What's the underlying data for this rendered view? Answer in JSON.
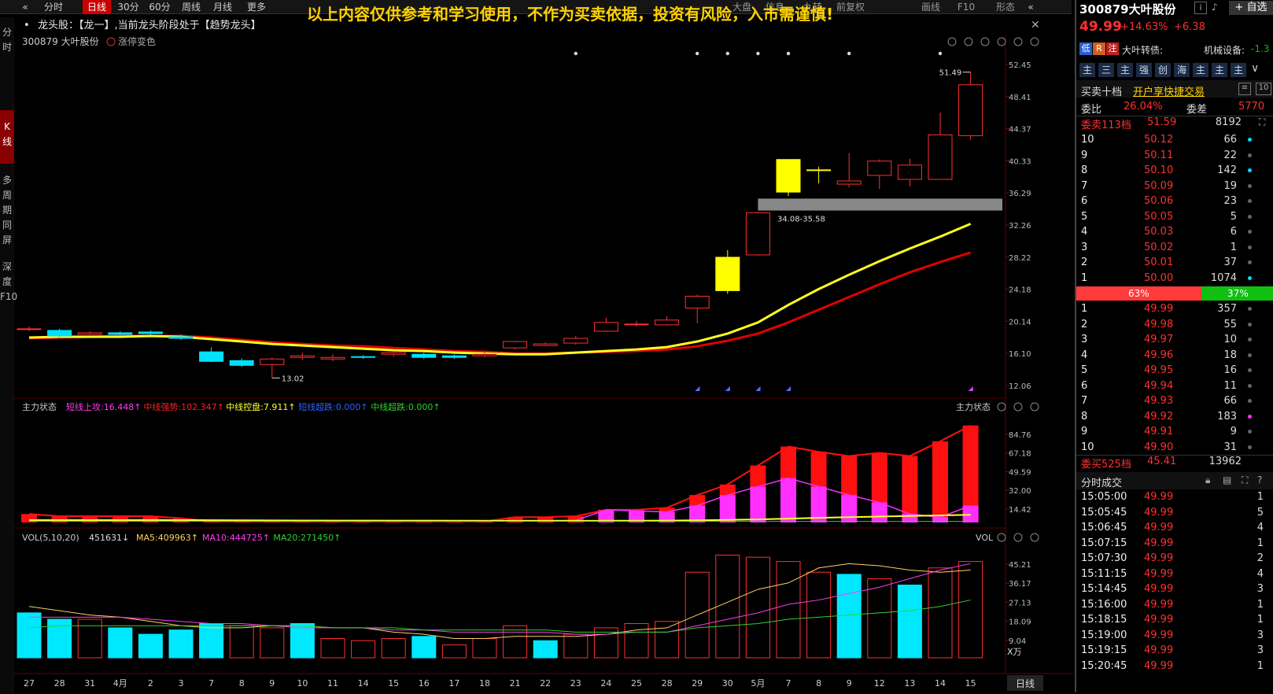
{
  "toolbar": {
    "tabs": [
      "分时",
      "日线",
      "30分",
      "60分",
      "周线",
      "月线",
      "更多"
    ],
    "active_tab": "日线",
    "right_tabs": [
      "大盘",
      "信息",
      "九转",
      "前复权",
      "画线",
      "F10",
      "形态"
    ]
  },
  "banner": "以上内容仅供参考和学习使用，不作为买卖依据，投资有风险，入市需谨慎!",
  "leftnav": {
    "fenshi": "分时",
    "kxian": "K线",
    "duozhouqi": "多周期同屏",
    "shendu": "深度F10"
  },
  "info_line": "龙头股：【龙一】,当前龙头阶段处于【趋势龙头】",
  "chart_header": {
    "code_name": "300879 大叶股份",
    "limit_toggle": "涨停变色"
  },
  "price_axis": [
    "52.45",
    "48.41",
    "44.37",
    "40.33",
    "36.29",
    "32.26",
    "28.22",
    "24.18",
    "20.14",
    "16.10",
    "12.06"
  ],
  "annotations": {
    "high": "51.49",
    "low": "13.02",
    "gap": "34.08-35.58"
  },
  "indicator1": {
    "title": "主力状态",
    "items": [
      {
        "label": "短线上攻:16.448",
        "color": "#ff3cf0"
      },
      {
        "label": "中线强势:102.347",
        "color": "#ff2020"
      },
      {
        "label": "中线控盘:7.911",
        "color": "#ffff30"
      },
      {
        "label": "短线超跌:0.000",
        "color": "#3060ff"
      },
      {
        "label": "中线超跌:0.000",
        "color": "#30d030"
      }
    ],
    "right_title": "主力状态",
    "axis": [
      "84.76",
      "67.18",
      "49.59",
      "32.00",
      "14.42"
    ]
  },
  "indicator2": {
    "title": "VOL(5,10,20)",
    "value": "451631",
    "items": [
      {
        "label": "MA5:409963",
        "color": "#ffd060"
      },
      {
        "label": "MA10:444725",
        "color": "#ff3cf0"
      },
      {
        "label": "MA20:271450",
        "color": "#30d030"
      }
    ],
    "right_title": "VOL",
    "axis": [
      "45.21",
      "36.17",
      "27.13",
      "18.09",
      "9.04"
    ],
    "unit": "X万"
  },
  "date_axis": [
    "27",
    "28",
    "31",
    "4月",
    "2",
    "3",
    "7",
    "8",
    "9",
    "10",
    "11",
    "14",
    "15",
    "16",
    "17",
    "18",
    "21",
    "22",
    "23",
    "24",
    "25",
    "28",
    "29",
    "30",
    "5月",
    "7",
    "8",
    "9",
    "12",
    "13",
    "14",
    "15"
  ],
  "period_label": "日线",
  "chart_data": {
    "type": "candlestick",
    "ylim": [
      12.06,
      52.45
    ],
    "open": [
      19.2,
      19.0,
      18.5,
      18.7,
      18.8,
      18.2,
      16.3,
      15.2,
      14.7,
      15.6,
      15.4,
      15.7,
      16.0,
      16.0,
      15.8,
      15.8,
      16.8,
      17.1,
      17.4,
      18.9,
      19.7,
      19.7,
      21.8,
      24.0,
      28.5,
      36.4,
      39.2,
      37.4,
      38.5,
      38.0,
      38.0,
      43.5
    ],
    "close": [
      19.2,
      18.3,
      18.7,
      18.5,
      18.6,
      18.0,
      15.1,
      14.6,
      15.4,
      15.8,
      15.6,
      15.6,
      16.2,
      15.6,
      15.6,
      16.0,
      17.6,
      17.3,
      18.0,
      20.0,
      19.8,
      20.3,
      23.3,
      28.2,
      33.8,
      40.5,
      39.2,
      37.8,
      40.3,
      39.8,
      43.6,
      49.9
    ],
    "high": [
      19.5,
      19.2,
      18.9,
      18.9,
      19.0,
      18.5,
      16.9,
      15.5,
      15.6,
      16.2,
      16.0,
      15.9,
      16.4,
      16.2,
      16.0,
      16.3,
      17.7,
      17.5,
      18.3,
      20.6,
      20.2,
      20.8,
      23.5,
      29.1,
      33.9,
      40.5,
      39.6,
      41.3,
      40.5,
      40.6,
      46.4,
      51.49
    ],
    "low": [
      18.9,
      18.1,
      18.3,
      18.3,
      18.4,
      17.8,
      15.0,
      14.4,
      13.02,
      15.3,
      15.1,
      15.4,
      15.7,
      15.4,
      15.4,
      15.6,
      16.6,
      17.0,
      17.2,
      18.8,
      19.5,
      19.6,
      19.9,
      23.6,
      28.4,
      35.9,
      37.5,
      37.0,
      36.8,
      37.1,
      38.0,
      43.0
    ],
    "limit_up_days": [
      23,
      25,
      26
    ],
    "ma_yellow": [
      18.1,
      18.2,
      18.2,
      18.2,
      18.3,
      18.2,
      17.9,
      17.6,
      17.3,
      17.1,
      16.9,
      16.7,
      16.5,
      16.4,
      16.2,
      16.1,
      16.0,
      16.0,
      16.2,
      16.4,
      16.6,
      16.9,
      17.6,
      18.6,
      20.0,
      22.2,
      24.2,
      26.0,
      27.7,
      29.3,
      30.8,
      32.4
    ],
    "ma_red": [
      18.0,
      18.1,
      18.2,
      18.3,
      18.3,
      18.3,
      18.1,
      17.8,
      17.5,
      17.3,
      17.1,
      17.0,
      16.8,
      16.6,
      16.4,
      16.3,
      16.1,
      16.1,
      16.2,
      16.3,
      16.4,
      16.6,
      17.0,
      17.7,
      18.6,
      20.0,
      21.6,
      23.2,
      24.8,
      26.3,
      27.6,
      28.8
    ],
    "indicator_red": [
      8,
      6,
      6,
      6,
      6,
      4,
      1,
      1,
      1,
      1,
      1,
      1,
      1,
      1,
      1,
      1,
      5,
      5,
      6,
      12,
      12,
      14,
      26,
      36,
      54,
      72,
      67,
      63,
      66,
      63,
      77,
      92
    ],
    "indicator_magenta": [
      0,
      0,
      0,
      0,
      0,
      0,
      0,
      0,
      0,
      0,
      0,
      0,
      0,
      0,
      0,
      0,
      0,
      0,
      0,
      12,
      11,
      10,
      16,
      26,
      34,
      42,
      34,
      26,
      19,
      8,
      5,
      16
    ],
    "volume_wan": [
      21,
      18,
      18,
      14,
      11,
      13,
      16,
      15,
      14,
      16,
      9,
      8,
      9,
      10,
      6,
      9,
      15,
      8,
      11,
      14,
      16,
      17,
      40,
      48,
      47,
      45,
      40,
      39,
      37,
      34,
      42,
      45
    ],
    "volume_down_days": [
      0,
      1,
      3,
      4,
      5,
      6,
      9,
      13,
      17,
      27,
      29
    ],
    "vol_ma5": [
      24,
      22,
      20,
      19,
      17,
      15,
      14,
      14,
      15,
      15,
      14,
      14,
      12,
      11,
      9,
      9,
      10,
      10,
      10,
      11,
      13,
      14,
      20,
      26,
      32,
      35,
      42,
      44,
      43,
      41,
      40,
      41
    ],
    "vol_ma10": [
      19,
      19,
      19,
      19,
      18,
      17,
      16,
      16,
      15,
      14,
      14,
      14,
      13,
      13,
      12,
      12,
      12,
      12,
      11,
      11,
      12,
      12,
      15,
      18,
      21,
      25,
      27,
      30,
      33,
      37,
      41,
      44
    ],
    "vol_ma20": [
      14,
      15,
      15,
      15,
      15,
      15,
      15,
      15,
      15,
      15,
      14,
      14,
      14,
      13,
      13,
      13,
      13,
      13,
      12,
      12,
      12,
      12,
      14,
      15,
      16,
      18,
      19,
      20,
      21,
      22,
      24,
      27
    ],
    "vol_ylim": [
      0,
      50
    ]
  },
  "right_panel": {
    "stock_title": "300879大叶股份",
    "add_fav": "自选",
    "price": "49.99",
    "change_pct": "+14.63%",
    "change_abs": "+6.38",
    "tags": [
      "低",
      "R",
      "注"
    ],
    "convertible": "大叶转债:",
    "sector": "机械设备:",
    "sector_val": "-1.3",
    "tool_icons": [
      "主",
      "三",
      "主",
      "强",
      "创",
      "海",
      "主",
      "主",
      "主"
    ],
    "depth_title": "买卖十档",
    "quick_trade": "开户享快捷交易",
    "weibi_label": "委比",
    "weibi": "26.04%",
    "weicha_label": "委差",
    "weicha": "5770",
    "sell_total_label": "委卖113档",
    "sell_total_price": "51.59",
    "sell_total_vol": "8192",
    "sells": [
      {
        "lvl": "10",
        "price": "50.12",
        "vol": "66"
      },
      {
        "lvl": "9",
        "price": "50.11",
        "vol": "22"
      },
      {
        "lvl": "8",
        "price": "50.10",
        "vol": "142"
      },
      {
        "lvl": "7",
        "price": "50.09",
        "vol": "19"
      },
      {
        "lvl": "6",
        "price": "50.06",
        "vol": "23"
      },
      {
        "lvl": "5",
        "price": "50.05",
        "vol": "5"
      },
      {
        "lvl": "4",
        "price": "50.03",
        "vol": "6"
      },
      {
        "lvl": "3",
        "price": "50.02",
        "vol": "1"
      },
      {
        "lvl": "2",
        "price": "50.01",
        "vol": "37"
      },
      {
        "lvl": "1",
        "price": "50.00",
        "vol": "1074"
      }
    ],
    "ratio_left": "63%",
    "ratio_right": "37%",
    "ratio_left_value": 0.63,
    "buys": [
      {
        "lvl": "1",
        "price": "49.99",
        "vol": "357"
      },
      {
        "lvl": "2",
        "price": "49.98",
        "vol": "55"
      },
      {
        "lvl": "3",
        "price": "49.97",
        "vol": "10"
      },
      {
        "lvl": "4",
        "price": "49.96",
        "vol": "18"
      },
      {
        "lvl": "5",
        "price": "49.95",
        "vol": "16"
      },
      {
        "lvl": "6",
        "price": "49.94",
        "vol": "11"
      },
      {
        "lvl": "7",
        "price": "49.93",
        "vol": "66"
      },
      {
        "lvl": "8",
        "price": "49.92",
        "vol": "183"
      },
      {
        "lvl": "9",
        "price": "49.91",
        "vol": "9"
      },
      {
        "lvl": "10",
        "price": "49.90",
        "vol": "31"
      }
    ],
    "buy_total_label": "委买525档",
    "buy_total_price": "45.41",
    "buy_total_vol": "13962",
    "ticks_title": "分时成交",
    "ticks": [
      {
        "time": "15:05:00",
        "price": "49.99",
        "vol": "1"
      },
      {
        "time": "15:05:45",
        "price": "49.99",
        "vol": "5"
      },
      {
        "time": "15:06:45",
        "price": "49.99",
        "vol": "4"
      },
      {
        "time": "15:07:15",
        "price": "49.99",
        "vol": "1"
      },
      {
        "time": "15:07:30",
        "price": "49.99",
        "vol": "2"
      },
      {
        "time": "15:11:15",
        "price": "49.99",
        "vol": "4"
      },
      {
        "time": "15:14:45",
        "price": "49.99",
        "vol": "3"
      },
      {
        "time": "15:16:00",
        "price": "49.99",
        "vol": "1"
      },
      {
        "time": "15:18:15",
        "price": "49.99",
        "vol": "1"
      },
      {
        "time": "15:19:00",
        "price": "49.99",
        "vol": "3"
      },
      {
        "time": "15:19:15",
        "price": "49.99",
        "vol": "3"
      },
      {
        "time": "15:20:45",
        "price": "49.99",
        "vol": "1"
      }
    ]
  }
}
